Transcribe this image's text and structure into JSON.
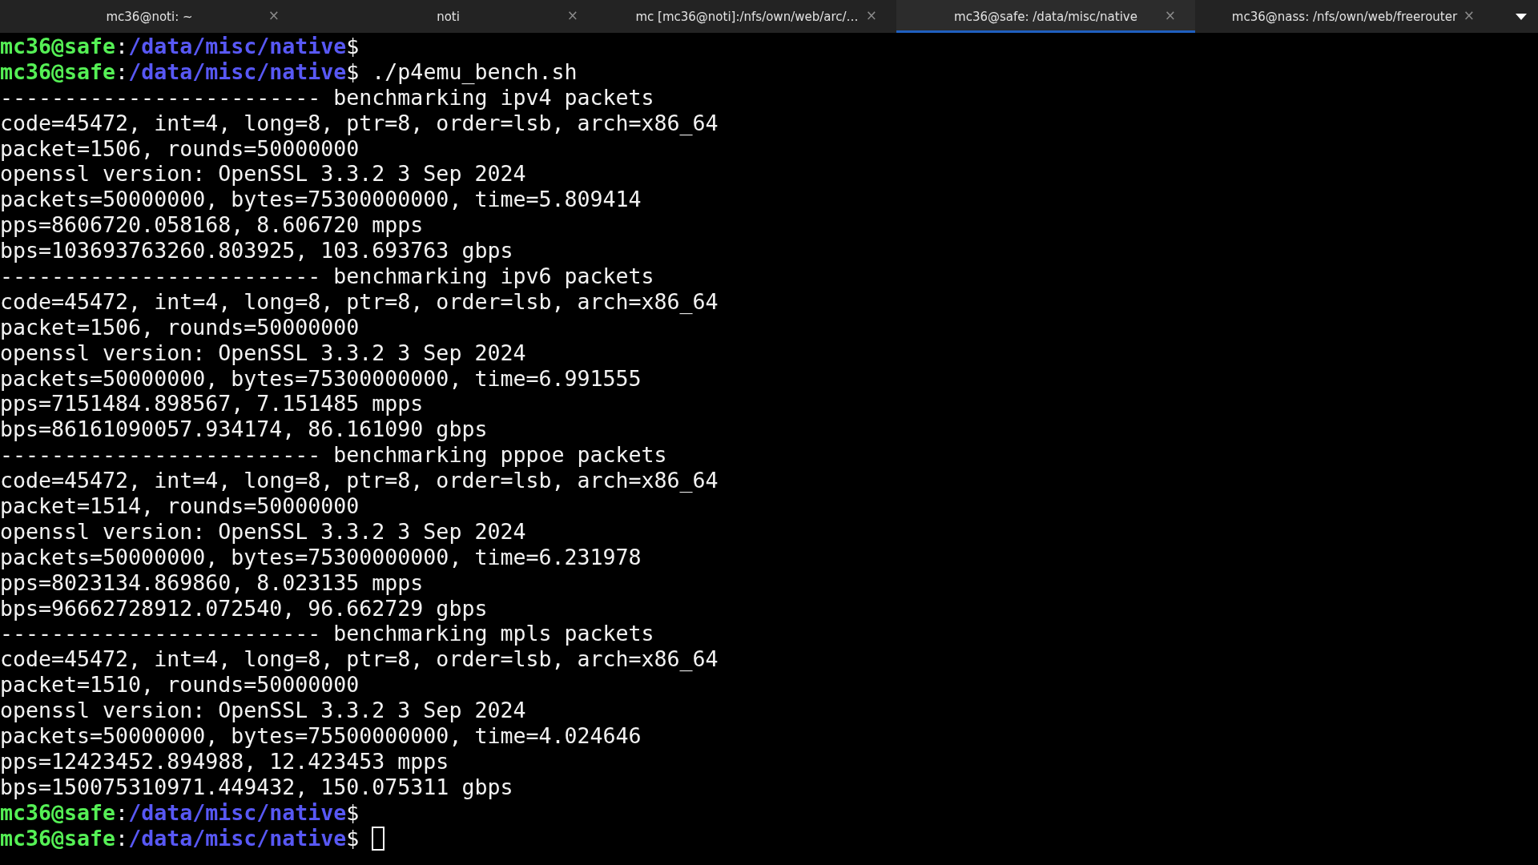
{
  "tabs": [
    {
      "title": "mc36@noti: ~",
      "selected": false,
      "close": "×"
    },
    {
      "title": "noti",
      "selected": false,
      "close": "×"
    },
    {
      "title": "mc [mc36@noti]:/nfs/own/web/arc/…",
      "selected": false,
      "close": "×"
    },
    {
      "title": "mc36@safe: /data/misc/native",
      "selected": true,
      "close": "×"
    },
    {
      "title": "mc36@nass: /nfs/own/web/freerouter",
      "selected": false,
      "close": "×"
    }
  ],
  "lines": [
    {
      "kind": "prompt",
      "user": "mc36@safe",
      "sep": ":",
      "path": "/data/misc/native",
      "sign": "$"
    },
    {
      "kind": "prompt",
      "user": "mc36@safe",
      "sep": ":",
      "path": "/data/misc/native",
      "sign": "$",
      "command": " ./p4emu_bench.sh"
    },
    {
      "kind": "output",
      "text": "------------------------- benchmarking ipv4 packets"
    },
    {
      "kind": "output",
      "text": "code=45472, int=4, long=8, ptr=8, order=lsb, arch=x86_64"
    },
    {
      "kind": "output",
      "text": "packet=1506, rounds=50000000"
    },
    {
      "kind": "output",
      "text": "openssl version: OpenSSL 3.3.2 3 Sep 2024"
    },
    {
      "kind": "output",
      "text": "packets=50000000, bytes=75300000000, time=5.809414"
    },
    {
      "kind": "output",
      "text": "pps=8606720.058168, 8.606720 mpps"
    },
    {
      "kind": "output",
      "text": "bps=103693763260.803925, 103.693763 gbps"
    },
    {
      "kind": "output",
      "text": "------------------------- benchmarking ipv6 packets"
    },
    {
      "kind": "output",
      "text": "code=45472, int=4, long=8, ptr=8, order=lsb, arch=x86_64"
    },
    {
      "kind": "output",
      "text": "packet=1506, rounds=50000000"
    },
    {
      "kind": "output",
      "text": "openssl version: OpenSSL 3.3.2 3 Sep 2024"
    },
    {
      "kind": "output",
      "text": "packets=50000000, bytes=75300000000, time=6.991555"
    },
    {
      "kind": "output",
      "text": "pps=7151484.898567, 7.151485 mpps"
    },
    {
      "kind": "output",
      "text": "bps=86161090057.934174, 86.161090 gbps"
    },
    {
      "kind": "output",
      "text": "------------------------- benchmarking pppoe packets"
    },
    {
      "kind": "output",
      "text": "code=45472, int=4, long=8, ptr=8, order=lsb, arch=x86_64"
    },
    {
      "kind": "output",
      "text": "packet=1514, rounds=50000000"
    },
    {
      "kind": "output",
      "text": "openssl version: OpenSSL 3.3.2 3 Sep 2024"
    },
    {
      "kind": "output",
      "text": "packets=50000000, bytes=75300000000, time=6.231978"
    },
    {
      "kind": "output",
      "text": "pps=8023134.869860, 8.023135 mpps"
    },
    {
      "kind": "output",
      "text": "bps=96662728912.072540, 96.662729 gbps"
    },
    {
      "kind": "output",
      "text": "------------------------- benchmarking mpls packets"
    },
    {
      "kind": "output",
      "text": "code=45472, int=4, long=8, ptr=8, order=lsb, arch=x86_64"
    },
    {
      "kind": "output",
      "text": "packet=1510, rounds=50000000"
    },
    {
      "kind": "output",
      "text": "openssl version: OpenSSL 3.3.2 3 Sep 2024"
    },
    {
      "kind": "output",
      "text": "packets=50000000, bytes=75500000000, time=4.024646"
    },
    {
      "kind": "output",
      "text": "pps=12423452.894988, 12.423453 mpps"
    },
    {
      "kind": "output",
      "text": "bps=150075310971.449432, 150.075311 gbps"
    },
    {
      "kind": "prompt",
      "user": "mc36@safe",
      "sep": ":",
      "path": "/data/misc/native",
      "sign": "$"
    },
    {
      "kind": "prompt",
      "user": "mc36@safe",
      "sep": ":",
      "path": "/data/misc/native",
      "sign": "$",
      "cursor": true
    }
  ]
}
